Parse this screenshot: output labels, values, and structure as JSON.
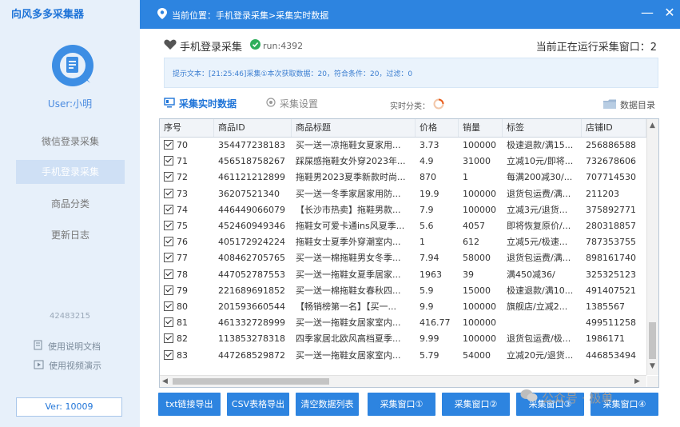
{
  "app": {
    "title": "向风多多采集器",
    "user": "User:小明",
    "code": "42483215",
    "version": "Ver: 10009"
  },
  "sidebar": {
    "items": [
      {
        "label": "微信登录采集"
      },
      {
        "label": "手机登录采集"
      },
      {
        "label": "商品分类"
      },
      {
        "label": "更新日志"
      }
    ],
    "doc_link": "使用说明文档",
    "video_link": "使用视频演示"
  },
  "topbar": {
    "breadcrumb": "当前位置：手机登录采集>采集实时数据",
    "minimize": "—",
    "close": "✕"
  },
  "header": {
    "title": "手机登录采集",
    "run": "run:4392",
    "running": "当前正在运行采集窗口：2"
  },
  "tips": "提示文本：[21:25:46]采集①本次获取数据：20，符合条件：20，过滤：0",
  "tabs": {
    "realtime_data": "采集实时数据",
    "settings": "采集设置",
    "realtime_category": "实时分类：",
    "data_dir": "数据目录"
  },
  "table": {
    "columns": [
      "序号",
      "商品ID",
      "商品标题",
      "价格",
      "销量",
      "标签",
      "店铺ID"
    ],
    "rows": [
      [
        "70",
        "354477238183",
        "买一送一凉拖鞋女夏家用...",
        "3.73",
        "100000",
        "极速退款/满15...",
        "256886588"
      ],
      [
        "71",
        "456518758267",
        "踩屎感拖鞋女外穿2023年...",
        "4.9",
        "31000",
        "立减10元/即将...",
        "732678606"
      ],
      [
        "72",
        "461121212899",
        "拖鞋男2023夏季新款时尚...",
        "870",
        "1",
        "每满200减30/...",
        "707714530"
      ],
      [
        "73",
        "36207521340",
        "买一送一冬季家居家用防...",
        "19.9",
        "100000",
        "退货包运费/满...",
        "211203"
      ],
      [
        "74",
        "446449066079",
        "【长沙市热卖】拖鞋男款...",
        "7.9",
        "100000",
        "立减3元/退货...",
        "375892771"
      ],
      [
        "75",
        "452460949346",
        "拖鞋女可爱卡通ins风夏季...",
        "5.6",
        "4057",
        "即将恢复原价/...",
        "280318857"
      ],
      [
        "76",
        "405172924224",
        "拖鞋女士夏季外穿潮室内...",
        "1",
        "612",
        "立减5元/极速...",
        "787353755"
      ],
      [
        "77",
        "408462705765",
        "买一送一棉拖鞋男女冬季...",
        "7.94",
        "58000",
        "退货包运费/满...",
        "898161740"
      ],
      [
        "78",
        "447052787553",
        "买一送一拖鞋女夏季居家...",
        "1963",
        "39",
        "满450减36/",
        "325325123"
      ],
      [
        "79",
        "221689691852",
        "买一送一棉拖鞋女春秋四...",
        "5.9",
        "15000",
        "极速退款/满10...",
        "491407521"
      ],
      [
        "80",
        "201593660544",
        "【畅销榜第一名】【买一...",
        "9.9",
        "100000",
        "旗舰店/立减2...",
        "1385567"
      ],
      [
        "81",
        "461332728999",
        "买一送一拖鞋女居家室内...",
        "416.77",
        "100000",
        "",
        "499511258"
      ],
      [
        "82",
        "113853278318",
        "四季家居北欧风高档夏季...",
        "9.99",
        "100000",
        "退货包运费/极...",
        "1986171"
      ],
      [
        "83",
        "447268529872",
        "买一送一拖鞋女居家室内...",
        "5.79",
        "54000",
        "立减20元/退货...",
        "446853494"
      ]
    ]
  },
  "buttons": {
    "txt_export": "txt链接导出",
    "csv_export": "CSV表格导出",
    "clear_list": "清空数据列表",
    "window1a": "采集窗口①",
    "window2": "采集窗口②",
    "window3": "采集窗口③",
    "window4": "采集窗口④"
  },
  "watermark": "公众号 · 极单",
  "colors": {
    "accent": "#2d84e0",
    "sidebar_bg": "#e7f0fa",
    "tips_text": "#3d7fd1"
  }
}
